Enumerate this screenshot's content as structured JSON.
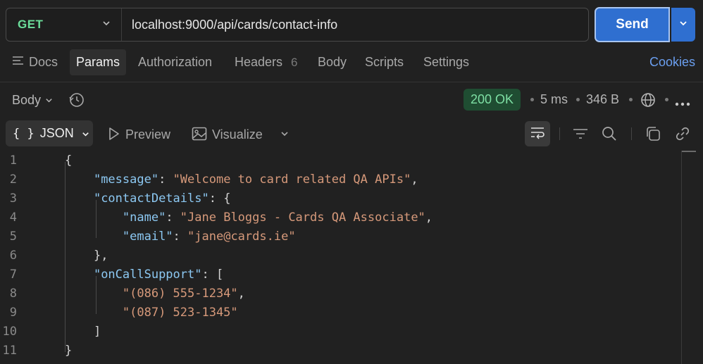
{
  "request": {
    "method": "GET",
    "url": "localhost:9000/api/cards/contact-info",
    "send_label": "Send"
  },
  "tabs": [
    {
      "label": "Docs"
    },
    {
      "label": "Params"
    },
    {
      "label": "Authorization"
    },
    {
      "label": "Headers",
      "count": "6"
    },
    {
      "label": "Body"
    },
    {
      "label": "Scripts"
    },
    {
      "label": "Settings"
    }
  ],
  "cookies_label": "Cookies",
  "response": {
    "body_label": "Body",
    "status": "200 OK",
    "time": "5 ms",
    "size": "346 B"
  },
  "view": {
    "format": "JSON",
    "preview": "Preview",
    "visualize": "Visualize"
  },
  "code": {
    "line_numbers": [
      "1",
      "2",
      "3",
      "4",
      "5",
      "6",
      "7",
      "8",
      "9",
      "10",
      "11"
    ],
    "l1": "{",
    "l2_key": "\"message\"",
    "l2_val": "\"Welcome to card related QA APIs\"",
    "l3_key": "\"contactDetails\"",
    "l3_rest": ": {",
    "l4_key": "\"name\"",
    "l4_val": "\"Jane Bloggs - Cards QA Associate\"",
    "l5_key": "\"email\"",
    "l5_val": "\"jane@cards.ie\"",
    "l6": "},",
    "l7_key": "\"onCallSupport\"",
    "l7_rest": ": [",
    "l8_val": "\"(086) 555-1234\"",
    "l9_val": "\"(087) 523-1345\"",
    "l10": "]",
    "l11": "}"
  },
  "colors": {
    "method_get": "#6bdd9a",
    "send": "#2f6fd0",
    "status_ok_bg": "#1f4d32",
    "status_ok_text": "#7ee0a4",
    "json_key": "#8cc8f2",
    "json_string": "#d6997a",
    "link": "#6b9ff0"
  },
  "icons": [
    "chevron-down-icon",
    "list-icon",
    "history-icon",
    "globe-icon",
    "more-icon",
    "play-icon",
    "image-icon",
    "wrap-icon",
    "filter-icon",
    "search-icon",
    "copy-icon",
    "link-icon"
  ]
}
